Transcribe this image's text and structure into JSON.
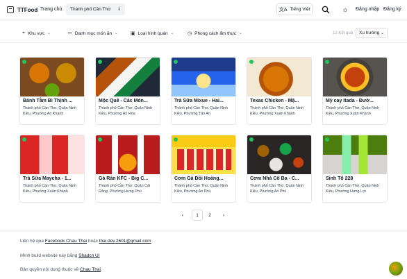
{
  "header": {
    "logo_text": "TTFood",
    "home": "Trang chủ",
    "city": "Thành phố Cần Thơ",
    "language": "Tiếng Việt",
    "login": "Đăng nhập",
    "register": "Đăng ký"
  },
  "filters": {
    "area": "Khu vực",
    "category": "Danh mục món ăn",
    "venue_type": "Loại hình quán",
    "cuisine_style": "Phong cách ẩm thực",
    "result_count": "12 Kết quả",
    "sort": "Xu hướng"
  },
  "cards": [
    {
      "title": "Bánh Tằm Bì Thịnh ...",
      "address": "Thành phố Cần Thơ, Quận Ninh Kiều, Phường An Khánh",
      "image": "food-bowls-photo"
    },
    {
      "title": "Mộc Quê - Các Món...",
      "address": "Thành phố Cần Thơ, Quận Ninh Kiều, Phường An Hòa",
      "image": "rice-trays-photo"
    },
    {
      "title": "Trà Sữa Mixue - Hai...",
      "address": "Thành phố Cần Thơ, Quận Ninh Kiều, Phường Tân An",
      "image": "ice-cream-photo"
    },
    {
      "title": "Texas Chicken - Mậ...",
      "address": "Thành phố Cần Thơ, Quận Ninh Kiều, Phường Xuân Khánh",
      "image": "fried-chicken-photo"
    },
    {
      "title": "Mỳ cay Itada - Đườ...",
      "address": "Thành phố Cần Thơ, Quận Ninh Kiều, Phường Xuân Khánh",
      "image": "spicy-noodle-photo"
    },
    {
      "title": "Trà Sữa Maycha - 1...",
      "address": "Thành phố Cần Thơ, Quận Ninh Kiều, Phường Xuân Khánh",
      "image": "milk-tea-photo"
    },
    {
      "title": "Gà Rán KFC - Big C...",
      "address": "Thành phố Cần Thơ, Quận Cái Răng, Phường Hưng Phú",
      "image": "kfc-bucket-photo"
    },
    {
      "title": "Cơm Gà Đồi Hoàng...",
      "address": "Thành phố Cần Thơ, Quận Ninh Kiều, Phường An Phú",
      "image": "chicken-rice-menu-photo"
    },
    {
      "title": "Cơm Nhà Cô Ba - C...",
      "address": "Thành phố Cần Thơ, Quận Ninh Kiều, Phường An Phú",
      "image": "family-meal-photo"
    },
    {
      "title": "Sinh Tố 228",
      "address": "Thành phố Cần Thơ, Quận Ninh Kiều, Phường Hưng Lợi",
      "image": "smoothie-photo"
    }
  ],
  "pagination": {
    "prev": "‹",
    "pages": [
      "1",
      "2"
    ],
    "current": "1",
    "next": "›"
  },
  "footer": {
    "contact_prefix": "Liên hệ qua",
    "contact_link": "Facebook Chau Thai",
    "contact_mid": "hoặc",
    "contact_email": "thai.dev.2601@gmail.com",
    "build_prefix": "Mình build website này bằng",
    "build_link": "Shadcn UI",
    "copyright_prefix": "Bản quyền nội dung thuộc về",
    "copyright_link": "Chau Thai"
  },
  "colors": {
    "open_dot": "#22c55e",
    "border": "#e5e7eb",
    "muted_text": "#9ca3af"
  }
}
